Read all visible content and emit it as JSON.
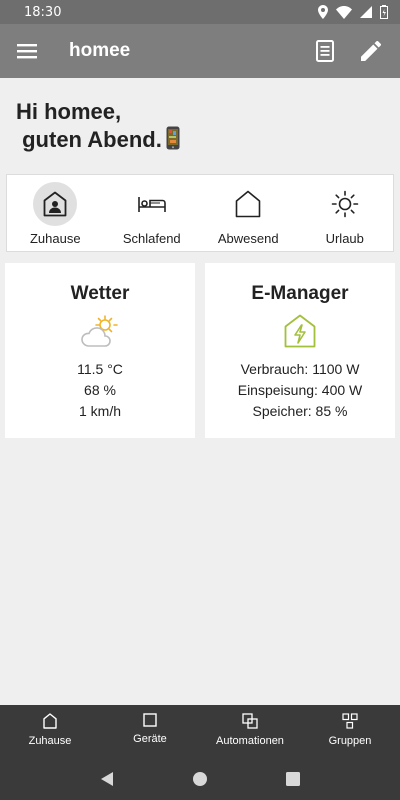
{
  "status": {
    "time": "18:30"
  },
  "appbar": {
    "title": "homee",
    "menu_icon": "hamburger-icon",
    "log_icon": "document-icon",
    "edit_icon": "pencil-icon"
  },
  "greeting": {
    "text": "Hi homee,\n guten Abend."
  },
  "modes": [
    {
      "label": "Zuhause",
      "icon": "home-icon",
      "active": true
    },
    {
      "label": "Schlafend",
      "icon": "bed-icon",
      "active": false
    },
    {
      "label": "Abwesend",
      "icon": "house-outline-icon",
      "active": false
    },
    {
      "label": "Urlaub",
      "icon": "sun-icon",
      "active": false
    }
  ],
  "weather": {
    "title": "Wetter",
    "icon": "partly-cloudy-icon",
    "temperature": "11.5 °C",
    "humidity": "68 %",
    "wind": "1 km/h"
  },
  "energy": {
    "title": "E-Manager",
    "icon": "energy-house-icon",
    "consumption": "Verbrauch: 1100 W",
    "feed_in": "Einspeisung: 400 W",
    "storage": "Speicher: 85 %",
    "accent": "#a2c03c"
  },
  "bottom_nav": [
    {
      "label": "Zuhause",
      "icon": "home-outline-icon"
    },
    {
      "label": "Geräte",
      "icon": "square-icon"
    },
    {
      "label": "Automationen",
      "icon": "overlapping-squares-icon"
    },
    {
      "label": "Gruppen",
      "icon": "grid-squares-icon"
    }
  ]
}
